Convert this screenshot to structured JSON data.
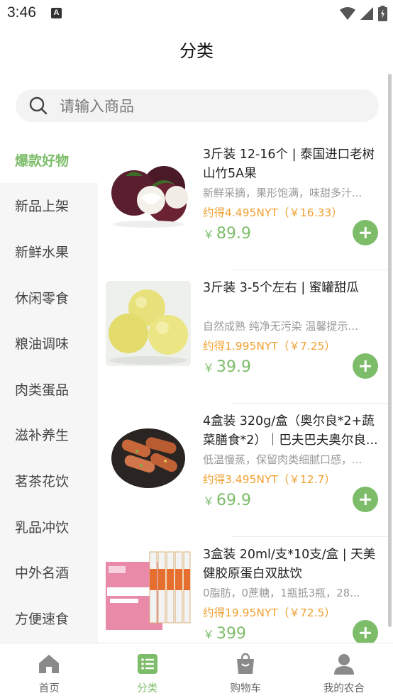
{
  "status_bar": {
    "time": "3:46",
    "notification_letter": "A"
  },
  "header": {
    "title": "分类"
  },
  "search": {
    "placeholder": "请输入商品"
  },
  "sidebar": {
    "items": [
      {
        "label": "爆款好物",
        "active": true
      },
      {
        "label": "新品上架"
      },
      {
        "label": "新鲜水果"
      },
      {
        "label": "休闲零食"
      },
      {
        "label": "粮油调味"
      },
      {
        "label": "肉类蛋品"
      },
      {
        "label": "滋补养生"
      },
      {
        "label": "茗茶花饮"
      },
      {
        "label": "乳品冲饮"
      },
      {
        "label": "中外名酒"
      },
      {
        "label": "方便速食"
      }
    ]
  },
  "products": [
    {
      "title": "3斤装 12-16个 | 泰国进口老树山竹5A果",
      "desc": "新鲜采摘，果形饱满，味甜多汁...",
      "earn": "约得4.495NYT（￥16.33）",
      "currency": "￥",
      "price": "89.9",
      "image_icon": "mangosteen-image"
    },
    {
      "title": "3斤装 3-5个左右 | 蜜罐甜瓜",
      "desc": "自然成熟 纯净无污染 温馨提示...",
      "earn": "约得1.995NYT（￥7.25）",
      "currency": "￥",
      "price": "39.9",
      "image_icon": "melon-image"
    },
    {
      "title": "4盒装 320g/盒（奥尔良*2+蔬菜膳食*2）｜巴夫巴夫奥尔良...",
      "desc": "低温慢蒸，保留肉类细腻口感，...",
      "earn": "约得3.495NYT（￥12.7）",
      "currency": "￥",
      "price": "69.9",
      "image_icon": "sausage-image"
    },
    {
      "title": "3盒装 20ml/支*10支/盒 | 天美健胶原蛋白双肽饮",
      "desc": "0脂肪，0蔗糖，1瓶抵3瓶，28...",
      "earn": "约得19.95NYT（￥72.5）",
      "currency": "￥",
      "price": "399",
      "image_icon": "collagen-drink-image"
    }
  ],
  "bottom_nav": {
    "items": [
      {
        "label": "首页",
        "icon": "home-icon"
      },
      {
        "label": "分类",
        "icon": "category-icon",
        "active": true
      },
      {
        "label": "购物车",
        "icon": "shopping-bag-icon"
      },
      {
        "label": "我的农合",
        "icon": "user-icon"
      }
    ]
  },
  "colors": {
    "accent": "#7dbd6a",
    "earn": "#f0a030"
  }
}
